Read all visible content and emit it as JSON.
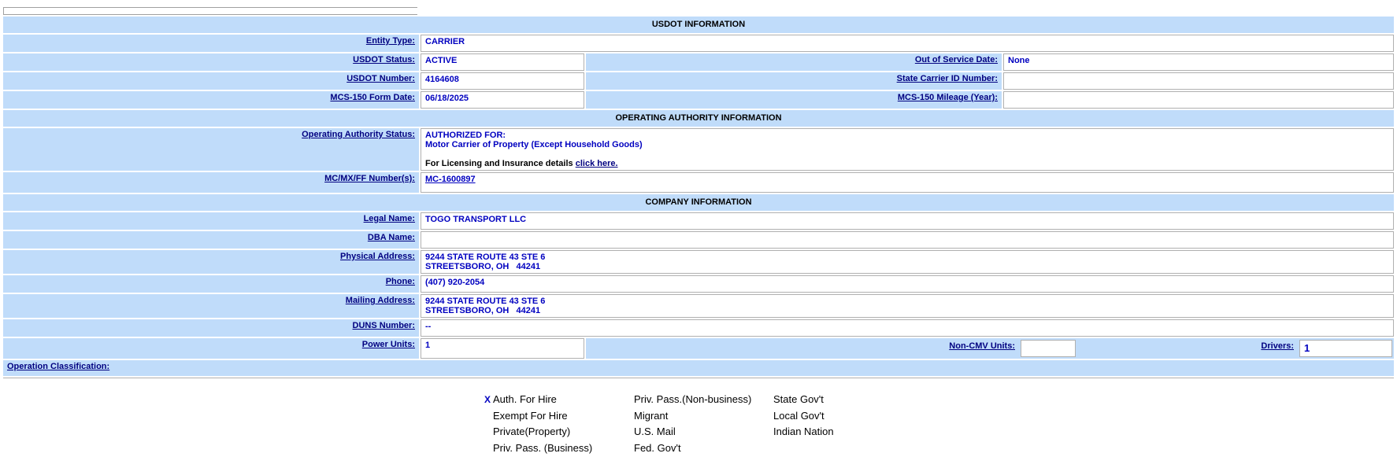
{
  "sections": {
    "usdot": "USDOT INFORMATION",
    "authority": "OPERATING AUTHORITY INFORMATION",
    "company": "COMPANY INFORMATION"
  },
  "usdot": {
    "entity_type_label": "Entity Type:",
    "entity_type": "CARRIER",
    "status_label": "USDOT Status:",
    "status": "ACTIVE",
    "oos_label": "Out of Service Date:",
    "oos": "None",
    "number_label": "USDOT Number:",
    "number": "4164608",
    "state_id_label": "State Carrier ID Number:",
    "state_id": "",
    "mcs150_label": "MCS-150 Form Date:",
    "mcs150": "06/18/2025",
    "mileage_label": "MCS-150 Mileage (Year):",
    "mileage": ""
  },
  "authority": {
    "status_label": "Operating Authority Status:",
    "line1": "AUTHORIZED FOR:",
    "line2": "Motor Carrier of Property (Except Household Goods)",
    "licensing_text": "For Licensing and Insurance details",
    "licensing_link": "click here.",
    "mc_label": "MC/MX/FF Number(s):",
    "mc": "MC-1600897"
  },
  "company": {
    "legal_label": "Legal Name:",
    "legal": "TOGO TRANSPORT LLC",
    "dba_label": "DBA Name:",
    "dba": "",
    "phys_label": "Physical Address:",
    "phys1": "9244 STATE ROUTE 43 STE 6",
    "phys2": "STREETSBORO, OH   44241",
    "phone_label": "Phone:",
    "phone": "(407) 920-2054",
    "mail_label": "Mailing Address:",
    "mail1": "9244 STATE ROUTE 43 STE 6",
    "mail2": "STREETSBORO, OH   44241",
    "duns_label": "DUNS Number:",
    "duns": "--",
    "power_label": "Power Units:",
    "power": "1",
    "noncmv_label": "Non-CMV Units:",
    "noncmv": "",
    "drivers_label": "Drivers:",
    "drivers": "1"
  },
  "operation": {
    "label": "Operation Classification:",
    "col1": [
      {
        "mark": "X",
        "text": "Auth. For Hire"
      },
      {
        "mark": "",
        "text": "Exempt For Hire"
      },
      {
        "mark": "",
        "text": "Private(Property)"
      },
      {
        "mark": "",
        "text": "Priv. Pass. (Business)"
      }
    ],
    "col2": [
      "Priv. Pass.(Non-business)",
      "Migrant",
      "U.S. Mail",
      "Fed. Gov't"
    ],
    "col3": [
      "State Gov't",
      "Local Gov't",
      "Indian Nation"
    ]
  }
}
